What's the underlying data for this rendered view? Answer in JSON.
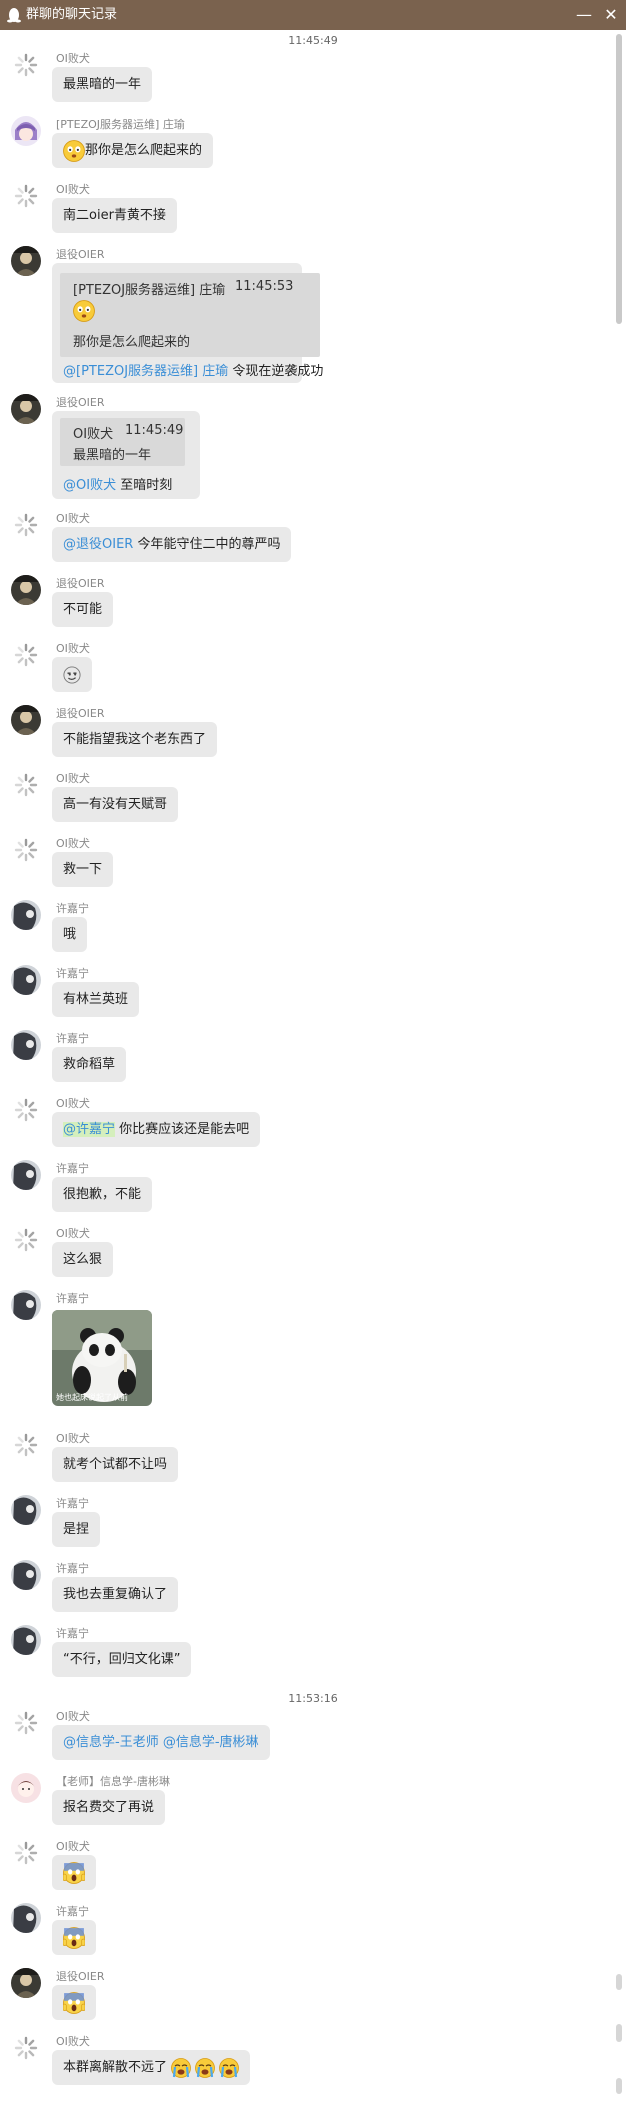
{
  "window": {
    "title": "群聊的聊天记录",
    "minimize_glyph": "—",
    "close_glyph": "✕"
  },
  "timestamps": [
    "11:45:49",
    "11:53:16"
  ],
  "senders": {
    "oi": "OI败犬",
    "zy": "[PTEZOJ服务器运维] 庄瑜",
    "ty": "退役OIER",
    "xjn": "许嘉宁",
    "teacher": "【老师】信息学-唐彬琳"
  },
  "messages": {
    "m1": "最黑暗的一年",
    "m2": "那你是怎么爬起来的",
    "m3": "南二oier青黄不接",
    "m4": {
      "quote_sender": "[PTEZOJ服务器运维] 庄瑜",
      "quote_time": "11:45:53",
      "quote_text": "那你是怎么爬起来的",
      "mention": "@[PTEZOJ服务器运维] 庄瑜",
      "text": "令现在逆袭成功"
    },
    "m5": {
      "quote_sender": "OI败犬",
      "quote_time": "11:45:49",
      "quote_text": "最黑暗的一年",
      "mention": "@OI败犬",
      "text": "至暗时刻"
    },
    "m6": {
      "mention": "@退役OIER",
      "text": "今年能守住二中的尊严吗"
    },
    "m7": "不可能",
    "m9": "不能指望我这个老东西了",
    "m10": "高一有没有天赋哥",
    "m11": "救一下",
    "m12": "哦",
    "m13": "有林兰英班",
    "m14": "救命稻草",
    "m15": {
      "mention": "@许嘉宁",
      "text": "你比赛应该还是能去吧"
    },
    "m16": "很抱歉，不能",
    "m17": "这么狠",
    "m18": {
      "caption": "她也起床说起了从前"
    },
    "m19": "就考个试都不让吗",
    "m20": "是捏",
    "m21": "我也去重复确认了",
    "m22": "“不行，回归文化课”",
    "m23": {
      "mention1": "@信息学-王老师",
      "mention2": "@信息学-唐彬琳"
    },
    "m24": "报名费交了再说",
    "m28": "本群离解散不远了"
  },
  "colors": {
    "titlebar": "#7a624e",
    "bubble": "#e9e9e9",
    "quote": "#d9d9d9",
    "mention": "#3a8ed6",
    "mention_highlight": "#d5efbc"
  }
}
